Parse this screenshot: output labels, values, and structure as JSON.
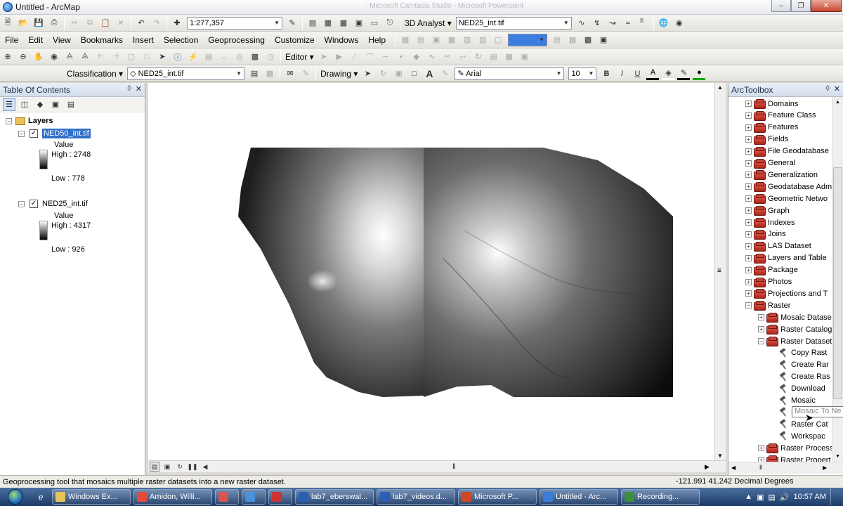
{
  "window": {
    "title": "Untitled - ArcMap",
    "ghost_title": "- Microsoft Camtasia Studio - Microsoft Powerpoint"
  },
  "toolbar1": {
    "scale": "1:277,357",
    "analyst_label": "3D Analyst ▾",
    "analyst_layer": "NED25_int.tif"
  },
  "menubar": {
    "items": [
      "File",
      "Edit",
      "View",
      "Bookmarks",
      "Insert",
      "Selection",
      "Geoprocessing",
      "Customize",
      "Windows",
      "Help"
    ]
  },
  "toolbar2": {
    "editor_label": "Editor ▾"
  },
  "toolbar3": {
    "classification_label": "Classification ▾",
    "classification_layer": "NED25_int.tif",
    "drawing_label": "Drawing ▾",
    "font_name": "Arial",
    "font_size": "10",
    "bold": "B",
    "italic": "I",
    "underline": "U"
  },
  "toc": {
    "title": "Table Of Contents",
    "root_label": "Layers",
    "layers": [
      {
        "name": "NED50_int.tif",
        "value_label": "Value",
        "high": "High : 2748",
        "low": "Low : 778",
        "checked": "✓"
      },
      {
        "name": "NED25_int.tif",
        "value_label": "Value",
        "high": "High : 4317",
        "low": "Low : 926",
        "checked": "✓"
      }
    ]
  },
  "arctoolbox": {
    "title": "ArcToolbox",
    "items": [
      {
        "label": "Domains",
        "kind": "toolset",
        "level": 0,
        "expander": "+"
      },
      {
        "label": "Feature Class",
        "kind": "toolset",
        "level": 0,
        "expander": "+"
      },
      {
        "label": "Features",
        "kind": "toolset",
        "level": 0,
        "expander": "+"
      },
      {
        "label": "Fields",
        "kind": "toolset",
        "level": 0,
        "expander": "+"
      },
      {
        "label": "File Geodatabase",
        "kind": "toolset",
        "level": 0,
        "expander": "+"
      },
      {
        "label": "General",
        "kind": "toolset",
        "level": 0,
        "expander": "+"
      },
      {
        "label": "Generalization",
        "kind": "toolset",
        "level": 0,
        "expander": "+"
      },
      {
        "label": "Geodatabase Adm",
        "kind": "toolset",
        "level": 0,
        "expander": "+"
      },
      {
        "label": "Geometric Netwo",
        "kind": "toolset",
        "level": 0,
        "expander": "+"
      },
      {
        "label": "Graph",
        "kind": "toolset",
        "level": 0,
        "expander": "+"
      },
      {
        "label": "Indexes",
        "kind": "toolset",
        "level": 0,
        "expander": "+"
      },
      {
        "label": "Joins",
        "kind": "toolset",
        "level": 0,
        "expander": "+"
      },
      {
        "label": "LAS Dataset",
        "kind": "toolset",
        "level": 0,
        "expander": "+"
      },
      {
        "label": "Layers and Table",
        "kind": "toolset",
        "level": 0,
        "expander": "+"
      },
      {
        "label": "Package",
        "kind": "toolset",
        "level": 0,
        "expander": "+"
      },
      {
        "label": "Photos",
        "kind": "toolset",
        "level": 0,
        "expander": "+"
      },
      {
        "label": "Projections and T",
        "kind": "toolset",
        "level": 0,
        "expander": "+"
      },
      {
        "label": "Raster",
        "kind": "toolset",
        "level": 0,
        "expander": "−"
      },
      {
        "label": "Mosaic Datase",
        "kind": "toolset",
        "level": 1,
        "expander": "+"
      },
      {
        "label": "Raster Catalog",
        "kind": "toolset",
        "level": 1,
        "expander": "+"
      },
      {
        "label": "Raster Dataset",
        "kind": "toolset",
        "level": 1,
        "expander": "−"
      },
      {
        "label": "Copy Rast",
        "kind": "tool",
        "level": 2,
        "expander": ""
      },
      {
        "label": "Create Rar",
        "kind": "tool",
        "level": 2,
        "expander": ""
      },
      {
        "label": "Create Ras",
        "kind": "tool",
        "level": 2,
        "expander": ""
      },
      {
        "label": "Download",
        "kind": "tool",
        "level": 2,
        "expander": ""
      },
      {
        "label": "Mosaic",
        "kind": "tool",
        "level": 2,
        "expander": ""
      },
      {
        "label": "Mosaic To Ne",
        "kind": "tool",
        "level": 2,
        "expander": ""
      },
      {
        "label": "Raster Cat",
        "kind": "tool",
        "level": 2,
        "expander": ""
      },
      {
        "label": "Workspac",
        "kind": "tool",
        "level": 2,
        "expander": ""
      },
      {
        "label": "Raster Process",
        "kind": "toolset",
        "level": 1,
        "expander": "+"
      },
      {
        "label": "Raster Propert",
        "kind": "toolset",
        "level": 1,
        "expander": "+"
      }
    ],
    "tooltip": "Mosaic To Ne"
  },
  "statusbar": {
    "message": "Geoprocessing tool that mosaics multiple raster datasets into a new raster dataset.",
    "coords": "-121.991  41.242 Decimal Degrees"
  },
  "taskbar": {
    "tasks": [
      {
        "label": "Windows Ex...",
        "color": "#e8c35a"
      },
      {
        "label": "Amidon, Willi...",
        "color": "#e04b3a"
      },
      {
        "label": "",
        "color": "#d9534f"
      },
      {
        "label": "",
        "color": "#4a90d9"
      },
      {
        "label": "",
        "color": "#c33"
      },
      {
        "label": "lab7_eberswal...",
        "color": "#2b5fb4"
      },
      {
        "label": "lab7_videos.d...",
        "color": "#2b5fb4"
      },
      {
        "label": "Microsoft P...",
        "color": "#d24726"
      },
      {
        "label": "Untitled - Arc...",
        "color": "#3b7dd8"
      },
      {
        "label": "Recording...",
        "color": "#3d8f3d"
      }
    ],
    "clock": "10:57 AM"
  }
}
